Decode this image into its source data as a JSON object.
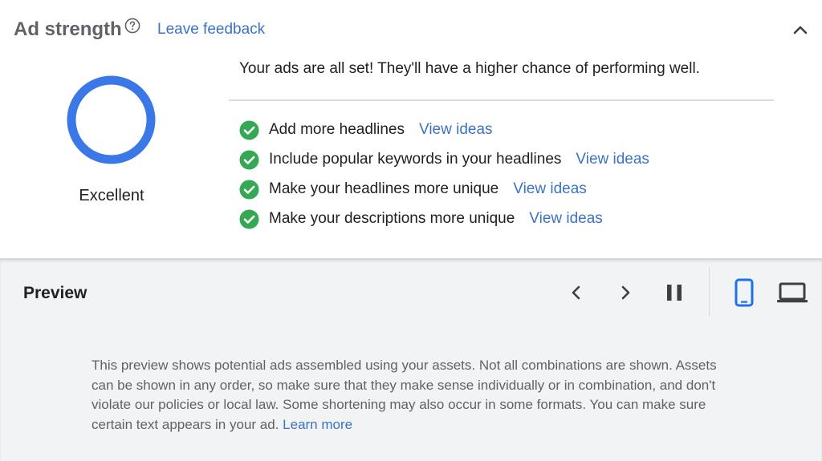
{
  "ad_strength": {
    "title": "Ad strength",
    "feedback_link": "Leave feedback",
    "rating": "Excellent",
    "rating_color": "#3b78e7",
    "status_message": "Your ads are all set! They'll have a higher chance of performing well.",
    "suggestions": [
      {
        "text": "Add more headlines",
        "link": "View ideas",
        "icon": "check-circle-icon"
      },
      {
        "text": "Include popular keywords in your headlines",
        "link": "View ideas",
        "icon": "check-circle-icon"
      },
      {
        "text": "Make your headlines more unique",
        "link": "View ideas",
        "icon": "check-circle-icon"
      },
      {
        "text": "Make your descriptions more unique",
        "link": "View ideas",
        "icon": "check-circle-icon"
      }
    ]
  },
  "preview": {
    "title": "Preview",
    "controls": [
      "previous-icon",
      "next-icon",
      "pause-icon",
      "mobile-device-icon",
      "desktop-device-icon"
    ],
    "selected_device": "mobile",
    "disclaimer": "This preview shows potential ads assembled using your assets. Not all combinations are shown. Assets can be shown in any order, so make sure that they make sense individually or in combination, and don't violate our policies or local law. Some shortening may also occur in some formats. You can make sure certain text appears in your ad.",
    "learn_more": "Learn more"
  },
  "colors": {
    "link": "#3a73c4",
    "check": "#34a853",
    "accent": "#1a73e8",
    "preview_bg": "#f1f3f4"
  }
}
